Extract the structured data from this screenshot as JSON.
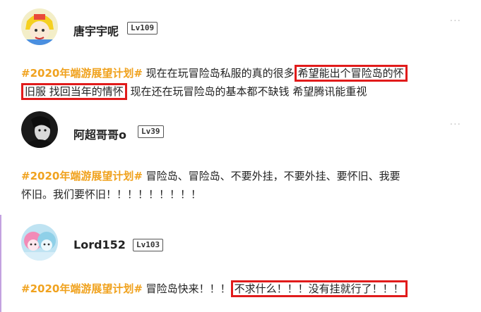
{
  "posts": [
    {
      "username": "唐宇宇呢",
      "level": "Lv109",
      "tag": "#2020年端游展望计划#",
      "text_a": " 现在在玩冒险岛私服的真的很多",
      "highlight_a": "希望能出个冒险岛的怀",
      "highlight_b": "旧服 找回当年的情怀",
      "text_b": " 现在还在玩冒险岛的基本都不缺钱 希望腾讯能重视"
    },
    {
      "username": "阿超哥哥o",
      "level": "Lv39",
      "tag": "#2020年端游展望计划#",
      "text_a": " 冒险岛、冒险岛、不要外挂，不要外挂、要怀旧、我要",
      "text_b": "怀旧。我们要怀旧！！！！！！！！！"
    },
    {
      "username": "Lord152",
      "level": "Lv103",
      "tag": "#2020年端游展望计划#",
      "text_a": " 冒险岛快来！！！",
      "highlight": "不求什么！！！没有挂就行了！！！"
    }
  ],
  "more_icon_glyph": "···"
}
